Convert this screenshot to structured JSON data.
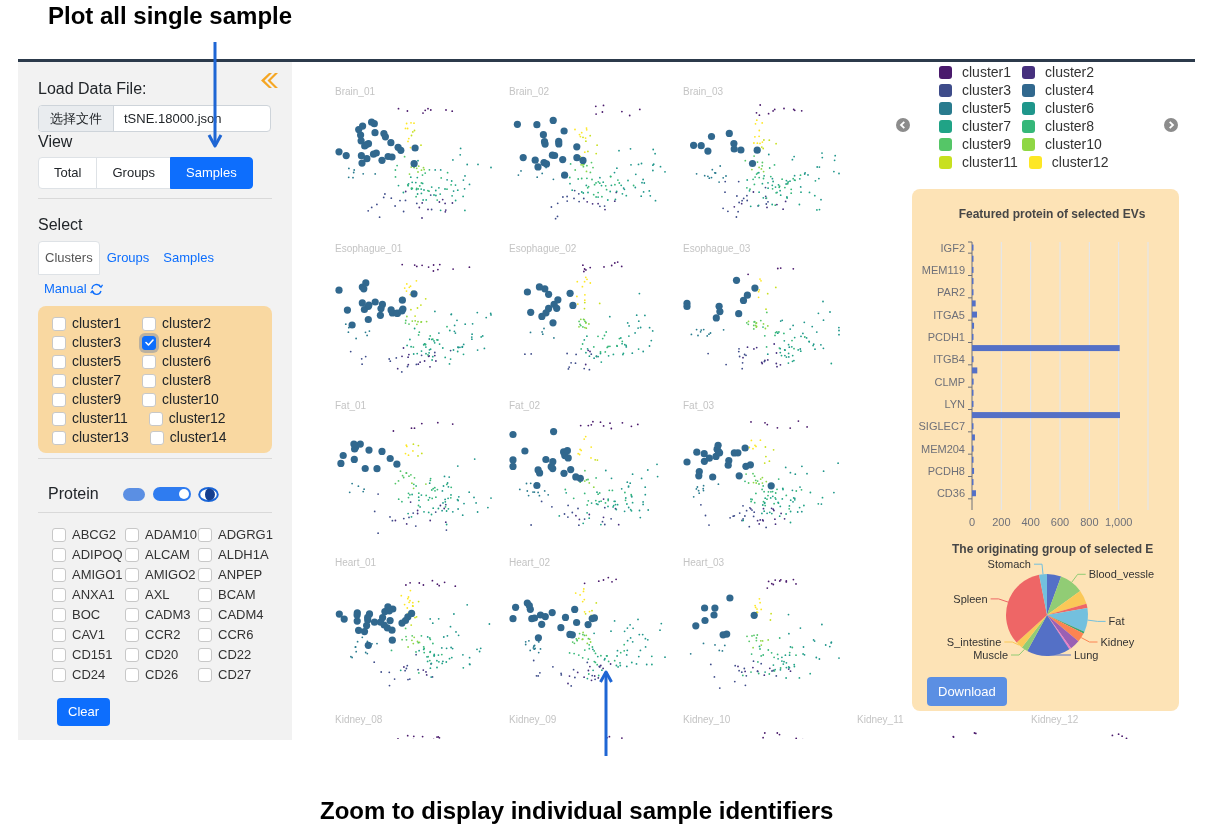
{
  "top_caption": "Plot all single sample",
  "sidebar": {
    "load_label": "Load Data File:",
    "file_input": {
      "button_label": "选择文件",
      "value": "tSNE.18000.json"
    },
    "view_label": "View",
    "view_buttons": [
      {
        "label": "Total",
        "selected": false
      },
      {
        "label": "Groups",
        "selected": false
      },
      {
        "label": "Samples",
        "selected": true
      }
    ],
    "select_label": "Select",
    "select_tabs": [
      {
        "label": "Clusters",
        "selected": true
      },
      {
        "label": "Groups",
        "selected": false
      },
      {
        "label": "Samples",
        "selected": false
      }
    ],
    "manual_link": "Manual",
    "clusters": [
      {
        "label": "cluster1",
        "checked": false
      },
      {
        "label": "cluster2",
        "checked": false
      },
      {
        "label": "cluster3",
        "checked": false
      },
      {
        "label": "cluster4",
        "checked": true
      },
      {
        "label": "cluster5",
        "checked": false
      },
      {
        "label": "cluster6",
        "checked": false
      },
      {
        "label": "cluster7",
        "checked": false
      },
      {
        "label": "cluster8",
        "checked": false
      },
      {
        "label": "cluster9",
        "checked": false
      },
      {
        "label": "cluster10",
        "checked": false
      },
      {
        "label": "cluster11",
        "checked": false
      },
      {
        "label": "cluster12",
        "checked": false
      },
      {
        "label": "cluster13",
        "checked": false
      },
      {
        "label": "cluster14",
        "checked": false
      }
    ],
    "protein_label": "Protein",
    "protein_switch": {
      "on": true
    },
    "proteins": [
      {
        "label": "ABCG2",
        "checked": false
      },
      {
        "label": "ADAM10",
        "checked": false
      },
      {
        "label": "ADGRG1",
        "checked": false
      },
      {
        "label": "ADIPOQ",
        "checked": false
      },
      {
        "label": "ALCAM",
        "checked": false
      },
      {
        "label": "ALDH1A",
        "checked": false
      },
      {
        "label": "AMIGO1",
        "checked": false
      },
      {
        "label": "AMIGO2",
        "checked": false
      },
      {
        "label": "ANPEP",
        "checked": false
      },
      {
        "label": "ANXA1",
        "checked": false
      },
      {
        "label": "AXL",
        "checked": false
      },
      {
        "label": "BCAM",
        "checked": false
      },
      {
        "label": "BOC",
        "checked": false
      },
      {
        "label": "CADM3",
        "checked": false
      },
      {
        "label": "CADM4",
        "checked": false
      },
      {
        "label": "CAV1",
        "checked": false
      },
      {
        "label": "CCR2",
        "checked": false
      },
      {
        "label": "CCR6",
        "checked": false
      },
      {
        "label": "CD151",
        "checked": false
      },
      {
        "label": "CD20",
        "checked": false
      },
      {
        "label": "CD22",
        "checked": false
      },
      {
        "label": "CD24",
        "checked": false
      },
      {
        "label": "CD26",
        "checked": false
      },
      {
        "label": "CD27",
        "checked": false
      }
    ],
    "clear_button": "Clear"
  },
  "sample_grid": {
    "rows": [
      [
        "Brain_01",
        "Brain_02",
        "Brain_03"
      ],
      [
        "Esophague_01",
        "Esophague_02",
        "Esophague_03"
      ],
      [
        "Fat_01",
        "Fat_02",
        "Fat_03"
      ],
      [
        "Heart_01",
        "Heart_02",
        "Heart_03"
      ],
      [
        "Kidney_08",
        "Kidney_09",
        "Kidney_10",
        "Kidney_11",
        "Kidney_12"
      ]
    ]
  },
  "legend": {
    "items": [
      {
        "label": "cluster1",
        "color": "#4a1a6c"
      },
      {
        "label": "cluster2",
        "color": "#46307e"
      },
      {
        "label": "cluster3",
        "color": "#3e4c8a"
      },
      {
        "label": "cluster4",
        "color": "#31688e"
      },
      {
        "label": "cluster5",
        "color": "#297b8e"
      },
      {
        "label": "cluster6",
        "color": "#1f968b"
      },
      {
        "label": "cluster7",
        "color": "#20a386"
      },
      {
        "label": "cluster8",
        "color": "#35b779"
      },
      {
        "label": "cluster9",
        "color": "#55c667"
      },
      {
        "label": "cluster10",
        "color": "#8fd744"
      },
      {
        "label": "cluster11",
        "color": "#c8e020"
      },
      {
        "label": "cluster12",
        "color": "#fde725"
      }
    ]
  },
  "feature_panel": {
    "bar_chart": {
      "chart_data": {
        "type": "bar",
        "orientation": "horizontal",
        "title": "Featured protein of selected EVs",
        "categories": [
          "IGF2",
          null,
          "MEM119",
          null,
          "PAR2",
          null,
          "ITGA5",
          null,
          "PCDH1",
          null,
          "ITGB4",
          null,
          "CLMP",
          null,
          "LYN",
          null,
          "SIGLEC7",
          null,
          "MEM204",
          null,
          "PCDH8",
          null,
          "CD36",
          null
        ],
        "values": [
          3,
          5,
          2,
          5,
          5,
          25,
          34,
          14,
          3,
          1007,
          9,
          36,
          11,
          5,
          2,
          1009,
          4,
          20,
          5,
          3,
          14,
          6,
          27,
          0
        ],
        "xticks": [
          0,
          200,
          400,
          600,
          800,
          {
            "value": 1000,
            "label": "1,000"
          }
        ],
        "xlim": [
          0,
          1200
        ],
        "grid": true
      }
    },
    "pie_chart": {
      "chart_data": {
        "type": "pie",
        "title": "The originating group of selected E",
        "categories": [
          null,
          "Blood_vessle",
          null,
          null,
          "Fat",
          null,
          "Kidney",
          null,
          null,
          "Lung",
          "Muscle",
          "S_intestine",
          "Spleen",
          "Stomach"
        ],
        "values": [
          5.6,
          9.4,
          5.6,
          1.7,
          9.4,
          0.8,
          3.6,
          3.9,
          0.8,
          17.2,
          2.5,
          2.8,
          33.6,
          3.1
        ]
      }
    },
    "download_button": "Download"
  },
  "bottom_caption": "Zoom to display individual sample identifiers"
}
